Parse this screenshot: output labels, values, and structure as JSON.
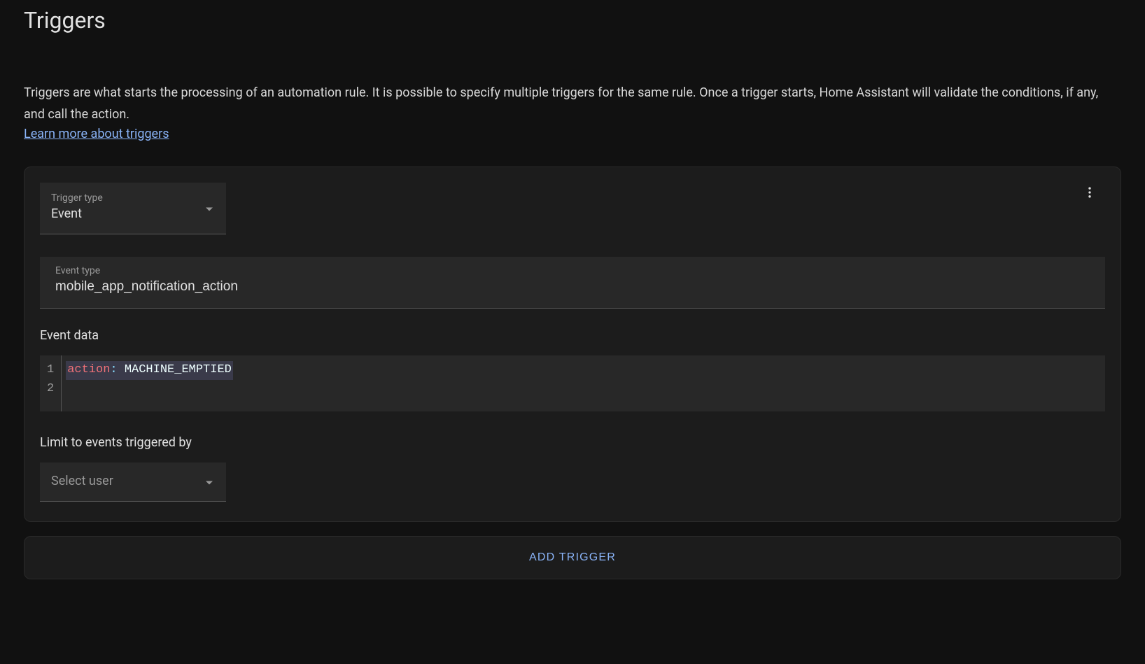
{
  "page": {
    "title": "Triggers",
    "description": "Triggers are what starts the processing of an automation rule. It is possible to specify multiple triggers for the same rule. Once a trigger starts, Home Assistant will validate the conditions, if any, and call the action.",
    "learn_link": "Learn more about triggers"
  },
  "trigger": {
    "type_label": "Trigger type",
    "type_value": "Event",
    "event_type_label": "Event type",
    "event_type_value": "mobile_app_notification_action",
    "event_data_label": "Event data",
    "code": {
      "line1_key": "action",
      "line1_colon": ":",
      "line1_val": " MACHINE_EMPTIED",
      "gutter1": "1",
      "gutter2": "2"
    },
    "limit_label": "Limit to events triggered by",
    "user_placeholder": "Select user"
  },
  "actions": {
    "add_trigger": "Add Trigger"
  }
}
